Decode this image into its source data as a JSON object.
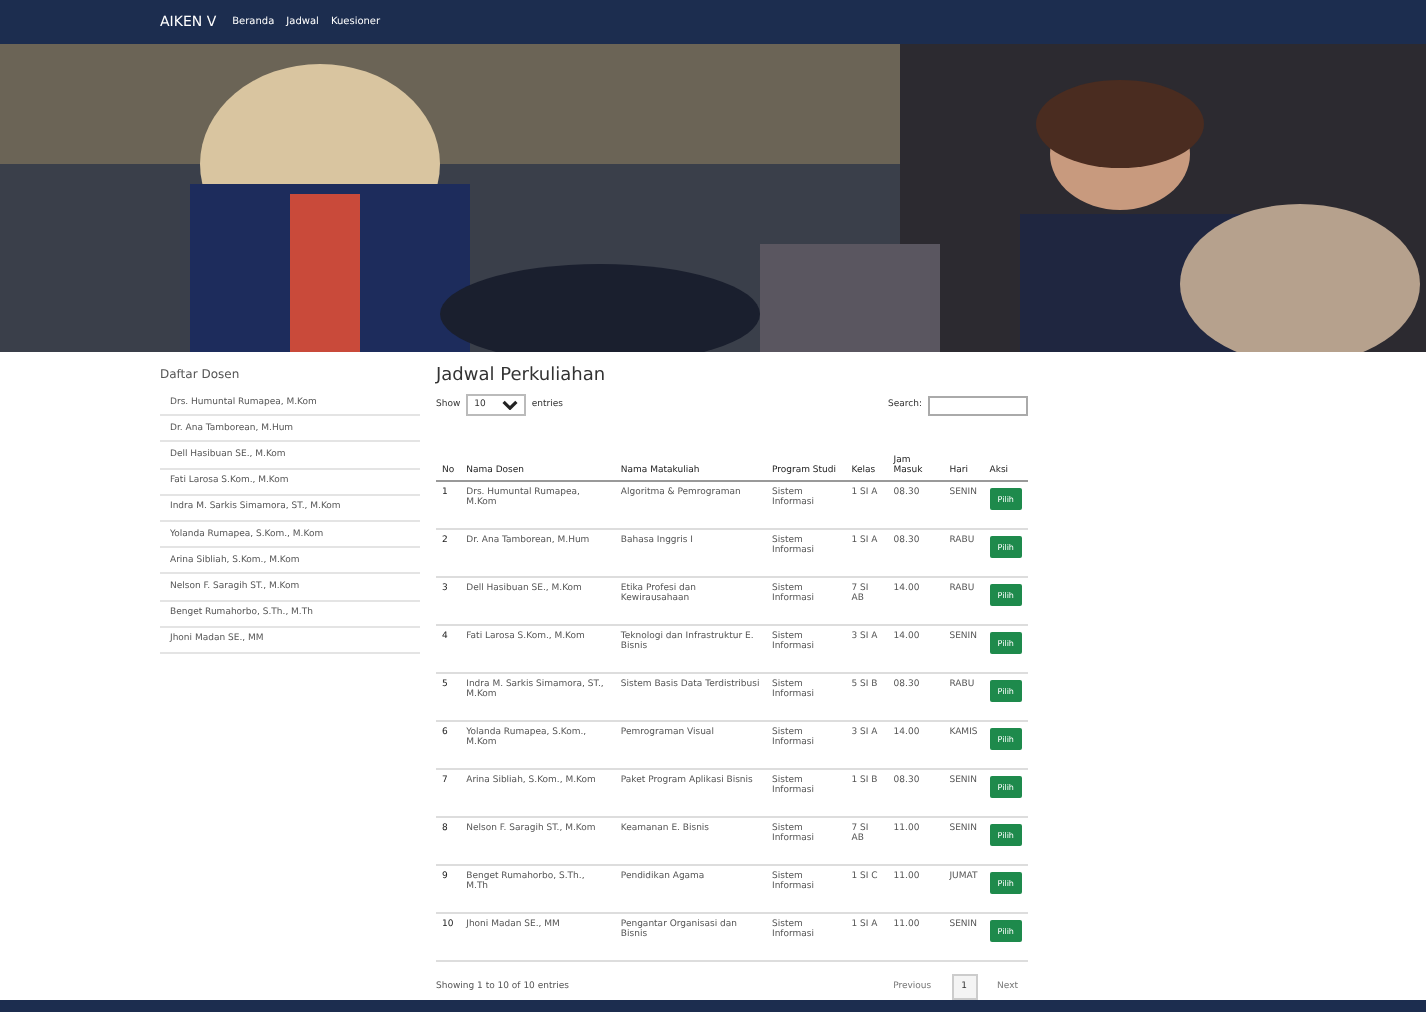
{
  "navbar": {
    "brand": "AIKEN V",
    "links": [
      "Beranda",
      "Jadwal",
      "Kuesioner"
    ]
  },
  "sidebar": {
    "title": "Daftar Dosen",
    "items": [
      "Drs. Humuntal Rumapea, M.Kom",
      "Dr. Ana Tamborean, M.Hum",
      "Dell Hasibuan SE., M.Kom",
      "Fati Larosa S.Kom., M.Kom",
      "Indra M. Sarkis Simamora, ST., M.Kom",
      "Yolanda Rumapea, S.Kom., M.Kom",
      "Arina Sibliah, S.Kom., M.Kom",
      "Nelson F. Saragih ST., M.Kom",
      "Benget Rumahorbo, S.Th., M.Th",
      "Jhoni Madan SE., MM"
    ]
  },
  "schedule": {
    "title": "Jadwal Perkuliahan",
    "show_label": "Show",
    "page_size": "10",
    "entries_label": "entries",
    "search_label": "Search:",
    "columns": [
      "No",
      "Nama Dosen",
      "Nama Matakuliah",
      "Program Studi",
      "Kelas",
      "Jam Masuk",
      "Hari",
      "Aksi"
    ],
    "rows": [
      {
        "no": "1",
        "dosen": "Drs. Humuntal Rumapea, M.Kom",
        "matkul": "Algoritma & Pemrograman",
        "prodi": "Sistem Informasi",
        "kelas": "1 SI A",
        "jam": "08.30",
        "hari": "SENIN",
        "aksi": "Pilih"
      },
      {
        "no": "2",
        "dosen": "Dr. Ana Tamborean, M.Hum",
        "matkul": "Bahasa Inggris I",
        "prodi": "Sistem Informasi",
        "kelas": "1 SI A",
        "jam": "08.30",
        "hari": "RABU",
        "aksi": "Pilih"
      },
      {
        "no": "3",
        "dosen": "Dell Hasibuan SE., M.Kom",
        "matkul": "Etika Profesi dan Kewirausahaan",
        "prodi": "Sistem Informasi",
        "kelas": "7 SI AB",
        "jam": "14.00",
        "hari": "RABU",
        "aksi": "Pilih"
      },
      {
        "no": "4",
        "dosen": "Fati Larosa S.Kom., M.Kom",
        "matkul": "Teknologi dan Infrastruktur E. Bisnis",
        "prodi": "Sistem Informasi",
        "kelas": "3 SI A",
        "jam": "14.00",
        "hari": "SENIN",
        "aksi": "Pilih"
      },
      {
        "no": "5",
        "dosen": "Indra M. Sarkis Simamora, ST., M.Kom",
        "matkul": "Sistem Basis Data Terdistribusi",
        "prodi": "Sistem Informasi",
        "kelas": "5 SI B",
        "jam": "08.30",
        "hari": "RABU",
        "aksi": "Pilih"
      },
      {
        "no": "6",
        "dosen": "Yolanda Rumapea, S.Kom., M.Kom",
        "matkul": "Pemrograman Visual",
        "prodi": "Sistem Informasi",
        "kelas": "3 SI A",
        "jam": "14.00",
        "hari": "KAMIS",
        "aksi": "Pilih"
      },
      {
        "no": "7",
        "dosen": "Arina Sibliah, S.Kom., M.Kom",
        "matkul": "Paket Program Aplikasi Bisnis",
        "prodi": "Sistem Informasi",
        "kelas": "1 SI B",
        "jam": "08.30",
        "hari": "SENIN",
        "aksi": "Pilih"
      },
      {
        "no": "8",
        "dosen": "Nelson F. Saragih ST., M.Kom",
        "matkul": "Keamanan E. Bisnis",
        "prodi": "Sistem Informasi",
        "kelas": "7 SI AB",
        "jam": "11.00",
        "hari": "SENIN",
        "aksi": "Pilih"
      },
      {
        "no": "9",
        "dosen": "Benget Rumahorbo, S.Th., M.Th",
        "matkul": "Pendidikan Agama",
        "prodi": "Sistem Informasi",
        "kelas": "1 SI C",
        "jam": "11.00",
        "hari": "JUMAT",
        "aksi": "Pilih"
      },
      {
        "no": "10",
        "dosen": "Jhoni Madan SE., MM",
        "matkul": "Pengantar Organisasi dan Bisnis",
        "prodi": "Sistem Informasi",
        "kelas": "1 SI A",
        "jam": "11.00",
        "hari": "SENIN",
        "aksi": "Pilih"
      }
    ],
    "info": "Showing 1 to 10 of 10 entries",
    "pagination": [
      {
        "label": "Previous",
        "selected": false
      },
      {
        "label": "1",
        "selected": true
      },
      {
        "label": "Next",
        "selected": false
      }
    ]
  }
}
